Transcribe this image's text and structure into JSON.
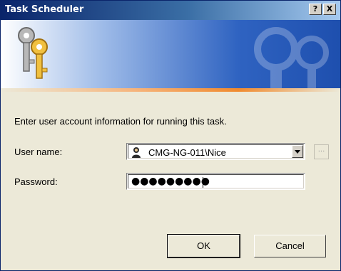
{
  "window": {
    "title": "Task Scheduler",
    "help_label": "?",
    "close_label": "X"
  },
  "prompt": "Enter user account information for running this task.",
  "user": {
    "label": "User name:",
    "value": "CMG-NG-011\\Nice",
    "browse_label": "..."
  },
  "password": {
    "label": "Password:",
    "masked": "●●●●●●●●●"
  },
  "buttons": {
    "ok": "OK",
    "cancel": "Cancel"
  },
  "colors": {
    "titlebar_start": "#0a246a",
    "banner_blue": "#2f63c1",
    "accent_orange": "#f08a2e",
    "dialog_bg": "#ece9d8"
  },
  "icons": [
    "keys-icon",
    "user-account-icon",
    "chevron-down-icon"
  ]
}
